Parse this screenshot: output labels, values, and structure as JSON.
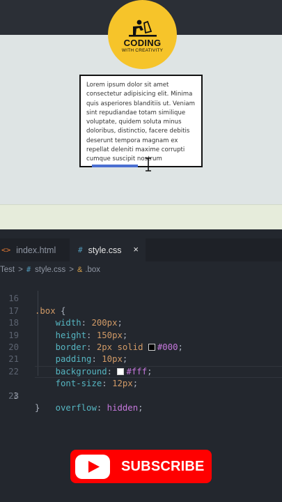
{
  "logo": {
    "title": "CODING",
    "subtitle": "WITH CREATIVITY",
    "color": "#f6c42a"
  },
  "preview": {
    "box_text": "Lorem ipsum dolor sit amet consectetur adipisicing elit. Minima quis asperiores blanditiis ut. Veniam sint repudiandae totam similique voluptate, quidem soluta minus doloribus, distinctio, facere debitis deserunt tempora magnam ex repellat deleniti maxime corrupti cumque suscipit nostrum"
  },
  "tabs": [
    {
      "glyph": "<>",
      "label": "index.html",
      "active": false
    },
    {
      "glyph": "#",
      "label": "style.css",
      "active": true
    }
  ],
  "tab_close": "×",
  "breadcrumb": {
    "root": "Test",
    "separator": ">",
    "file_glyph": "#",
    "file": "style.css",
    "selector_glyph": "&",
    "selector": ".box"
  },
  "code": {
    "active_line": "23",
    "lines": [
      {
        "num": "16",
        "selector": ".box",
        "brace": " {"
      },
      {
        "num": "17",
        "prop": "width",
        "value": "200px"
      },
      {
        "num": "18",
        "prop": "height",
        "value": "150px"
      },
      {
        "num": "19",
        "prop": "border",
        "value_pre": "2px solid ",
        "swatch": "#000000",
        "value_color": "#000"
      },
      {
        "num": "20",
        "prop": "padding",
        "value": "10px"
      },
      {
        "num": "21",
        "prop": "background",
        "swatch": "#ffffff",
        "value_color": "#fff"
      },
      {
        "num": "22",
        "prop": "font-size",
        "value": "12px"
      },
      {
        "num": "23",
        "prop": "overflow",
        "value_kw": "hidden"
      },
      {
        "num": "24",
        "close": "}"
      }
    ]
  },
  "subscribe": {
    "label": "SUBSCRIBE",
    "color": "#ff0000"
  }
}
